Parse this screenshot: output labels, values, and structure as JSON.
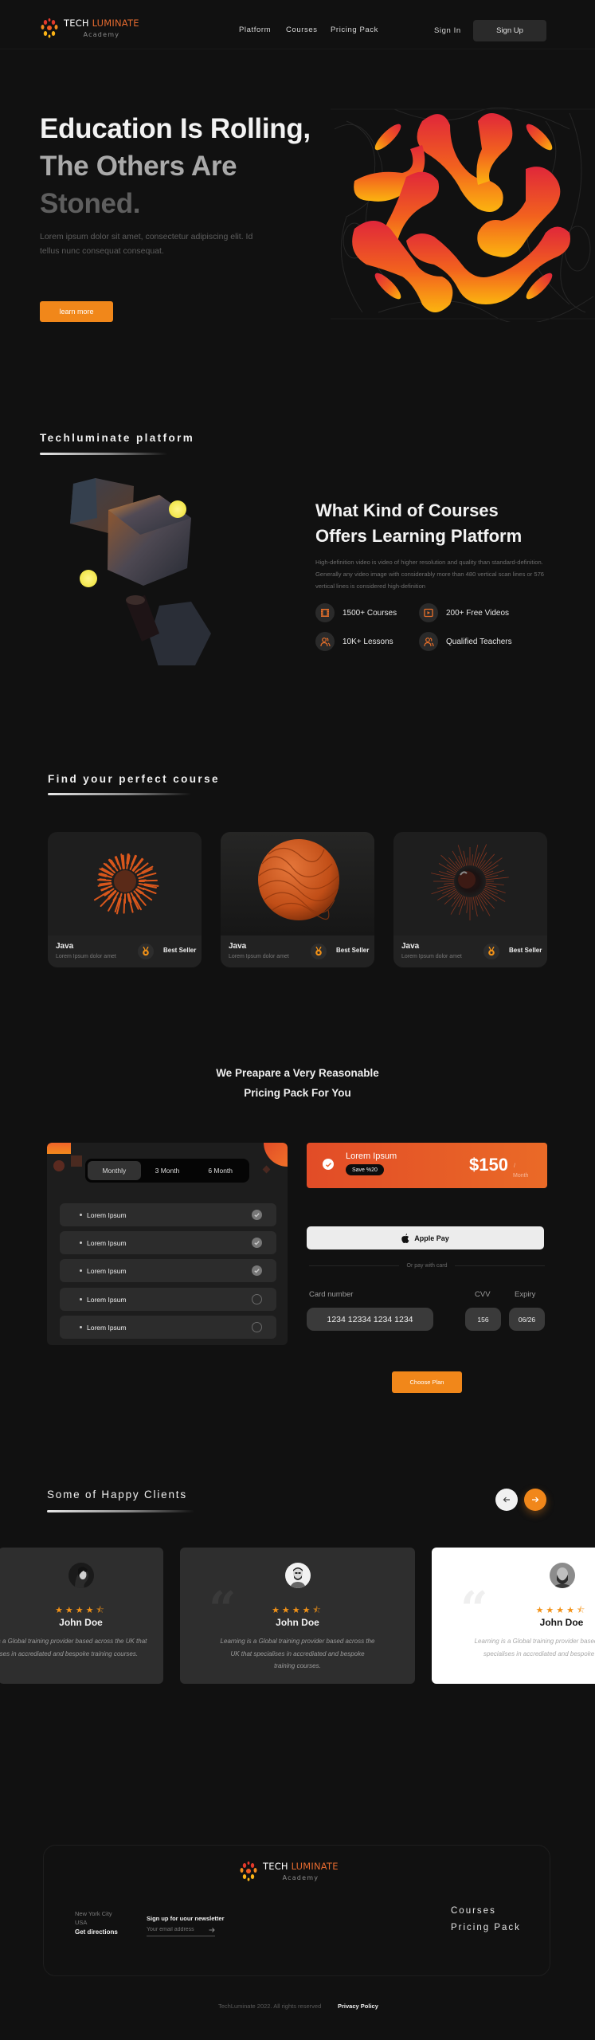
{
  "colors": {
    "accent": "#f1871a",
    "accent_red": "#e24c27",
    "background": "#111111",
    "card": "#2e2e2e"
  },
  "brand": {
    "name_part1": "TECH",
    "name_part2": "LUMINATE",
    "subtitle": "Academy"
  },
  "nav": {
    "links": [
      "Platform",
      "Courses",
      "Pricing Pack"
    ],
    "sign_in": "Sign In",
    "sign_up": "Sign Up"
  },
  "hero": {
    "title_lines": [
      "Education Is Rolling,",
      "The Others Are",
      "Stoned."
    ],
    "description": "Lorem ipsum dolor sit amet, consectetur adipiscing elit. Id tellus nunc consequat consequat.",
    "cta": "learn more",
    "illustration": "orange-molecule-pattern"
  },
  "platform": {
    "section_label": "Techluminate platform",
    "title": "What Kind of Courses Offers Learning Platform",
    "description": "High-definition video is video of higher resolution and quality than standard-definition. Generally any video image with considerably more than 480 vertical scan lines or 576 vertical lines is considered high-definition",
    "features": [
      {
        "icon": "film-icon",
        "label": "1500+ Courses"
      },
      {
        "icon": "play-video-icon",
        "label": "200+ Free Videos"
      },
      {
        "icon": "users-icon",
        "label": "10K+ Lessons"
      },
      {
        "icon": "users-icon",
        "label": "Qualified Teachers"
      }
    ]
  },
  "courses": {
    "section_label": "Find your perfect course",
    "items": [
      {
        "title": "Java",
        "subtitle": "Lorem Ipsum dolor amet",
        "badge": "Best Seller",
        "image": "orange-particle-burst"
      },
      {
        "title": "Java",
        "subtitle": "Lorem Ipsum dolor amet",
        "badge": "Best Seller",
        "image": "orange-wavy-sphere"
      },
      {
        "title": "Java",
        "subtitle": "Lorem Ipsum dolor amet",
        "badge": "Best Seller",
        "image": "dark-spiky-sphere"
      }
    ]
  },
  "pricing": {
    "title_line1": "We  Preapare a Very Reasonable",
    "title_line2": "Pricing Pack For You",
    "tabs": [
      "Monthly",
      "3 Month",
      "6 Month"
    ],
    "active_tab": "Monthly",
    "features": [
      {
        "label": "Lorem Ipsum",
        "checked": true
      },
      {
        "label": "Lorem Ipsum",
        "checked": true
      },
      {
        "label": "Lorem Ipsum",
        "checked": true
      },
      {
        "label": "Lorem Ipsum",
        "checked": false
      },
      {
        "label": "Lorem Ipsum",
        "checked": false
      }
    ],
    "selected_plan": {
      "name": "Lorem Ipsum",
      "badge": "Save %20",
      "price": "$150",
      "per": "/",
      "period": "Month"
    },
    "apple_pay": "Apple Pay",
    "divider": "Or pay with card",
    "card_number_label": "Card number",
    "card_number": "1234 12334 1234 1234",
    "cvv_label": "CVV",
    "cvv": "156",
    "expiry_label": "Expiry",
    "expiry": "06/26",
    "cta": "Choose Plan"
  },
  "clients": {
    "section_label": "Some of Happy Clients",
    "items": [
      {
        "name": "John Doe",
        "rating": 4.5,
        "quote": "Learning is a Global training provider based across the UK that specialises in accrediated and bespoke training courses.",
        "theme": "dark"
      },
      {
        "name": "John Doe",
        "rating": 4.5,
        "quote": "Learning is a Global training provider based across the UK that specialises in accrediated and bespoke training courses.",
        "theme": "dark"
      },
      {
        "name": "John Doe",
        "rating": 4.5,
        "quote": "Learning is a Global training provider based across the UK that specialises in accrediated and bespoke training courses.",
        "theme": "light"
      }
    ]
  },
  "footer": {
    "address_line1": "New York City",
    "address_line2": "USA",
    "directions": "Get directions",
    "newsletter_label": "Sign up for uour newsletter",
    "email_placeholder": "Your email address",
    "links": [
      "Courses",
      "Pricing Pack"
    ],
    "copyright": "TechLuminate 2022. All rights reserved",
    "privacy": "Privacy Policy"
  }
}
